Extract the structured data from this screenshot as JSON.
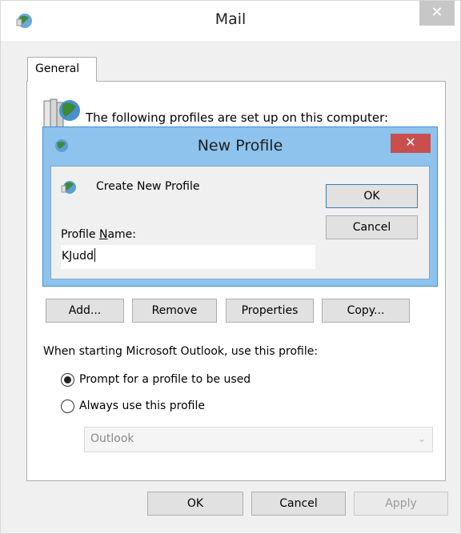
{
  "window": {
    "title": "Mail",
    "close_glyph": "✕"
  },
  "tabs": [
    {
      "label": "General",
      "selected": true
    }
  ],
  "profiles_text": "The following profiles are set up on this computer:",
  "profile_buttons": {
    "add": "Add...",
    "remove": "Remove",
    "properties": "Properties",
    "copy": "Copy..."
  },
  "startup": {
    "label": "When starting Microsoft Outlook, use this profile:",
    "option_prompt": "Prompt for a profile to be used",
    "option_always": "Always use this profile",
    "selected_option": "prompt",
    "profile_select_value": "Outlook",
    "profile_select_enabled": false
  },
  "footer": {
    "ok": "OK",
    "cancel": "Cancel",
    "apply": "Apply",
    "apply_enabled": false
  },
  "new_profile_dialog": {
    "title": "New Profile",
    "close_glyph": "✕",
    "create_label": "Create New Profile",
    "ok": "OK",
    "cancel": "Cancel",
    "profile_name_label_before": "Profile ",
    "profile_name_label_mnemonic": "N",
    "profile_name_label_after": "ame:",
    "profile_name_value": "KJudd"
  },
  "colors": {
    "dialog_bg": "#f0f0f0",
    "modal_frame": "#8ec3ee",
    "modal_close": "#c94f4f",
    "button_face": "#e1e1e1",
    "button_border": "#adadad",
    "default_button_border": "#3c7fb1"
  },
  "icons": {
    "title": "mail-globe-icon",
    "profiles": "profiles-folder-icon",
    "create": "new-profile-globe-icon"
  }
}
